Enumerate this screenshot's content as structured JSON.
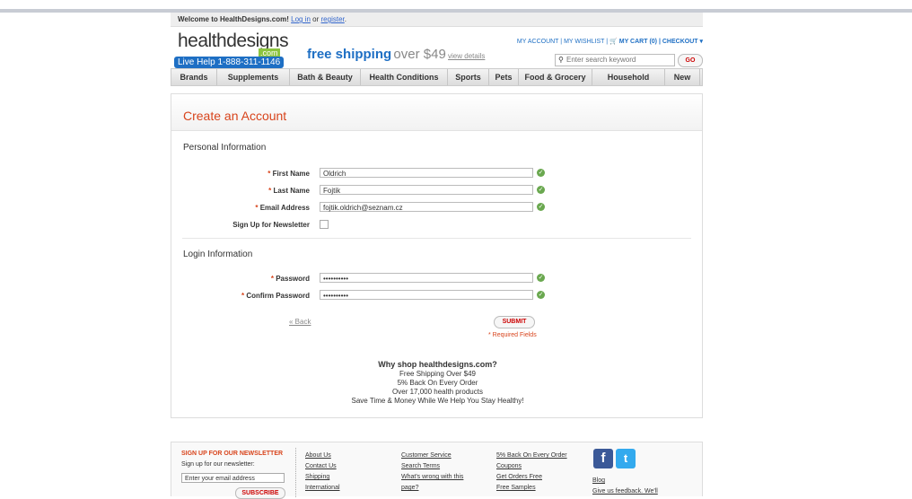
{
  "welcome": {
    "text": "Welcome to HealthDesigns.com!",
    "login": "Log in",
    "or": "or",
    "register": "register",
    "period": "."
  },
  "logo": {
    "main": "healthdesigns",
    "com": ".com",
    "live_help": "Live Help 1-888-311-1146"
  },
  "promo": {
    "strong": "free shipping",
    "rest": "over $49",
    "link": "view details"
  },
  "account_links": {
    "my_account": "MY ACCOUNT",
    "sep1": "|",
    "wishlist": "MY WISHLIST",
    "sep2": "|",
    "cart_icon": "cart-icon",
    "cart": "MY CART (0)",
    "sep3": "|",
    "checkout": "CHECKOUT ▾"
  },
  "search": {
    "icon": "search-icon",
    "placeholder": "Enter search keyword",
    "go": "GO"
  },
  "nav": [
    "Brands",
    "Supplements",
    "Bath & Beauty",
    "Health Conditions",
    "Sports",
    "Pets",
    "Food & Grocery",
    "Household",
    "New"
  ],
  "form": {
    "title": "Create an Account",
    "personal_title": "Personal Information",
    "first_name_label": "First Name",
    "first_name_value": "Oldrich",
    "last_name_label": "Last Name",
    "last_name_value": "Fojtik",
    "email_label": "Email Address",
    "email_value": "fojtik.oldrich@seznam.cz",
    "newsletter_label": "Sign Up for Newsletter",
    "login_title": "Login Information",
    "password_label": "Password",
    "password_value": "••••••••••",
    "confirm_label": "Confirm Password",
    "confirm_value": "••••••••••",
    "required_marker": "*",
    "back": "« Back",
    "submit": "SUBMIT",
    "required_note": "* Required Fields"
  },
  "why": {
    "title": "Why shop healthdesigns.com?",
    "lines": [
      "Free Shipping Over $49",
      "5% Back On Every Order",
      "Over 17,000 health products",
      "Save Time & Money While We Help You Stay Healthy!"
    ]
  },
  "footer": {
    "nl_title": "SIGN UP FOR OUR NEWSLETTER",
    "nl_sub": "Sign up for our newsletter:",
    "nl_placeholder": "Enter your email address",
    "subscribe": "SUBSCRIBE",
    "col1": [
      "About Us",
      "Contact Us",
      "Shipping",
      "International"
    ],
    "col2": [
      "Customer Service",
      "Search Terms",
      "What's wrong with this",
      "page?"
    ],
    "col3": [
      "5% Back On Every Order",
      "Coupons",
      "Get Orders Free",
      "Free Samples"
    ],
    "facebook": "f",
    "twitter": "t",
    "right": [
      "Blog",
      "Give us feedback. We'll"
    ]
  }
}
